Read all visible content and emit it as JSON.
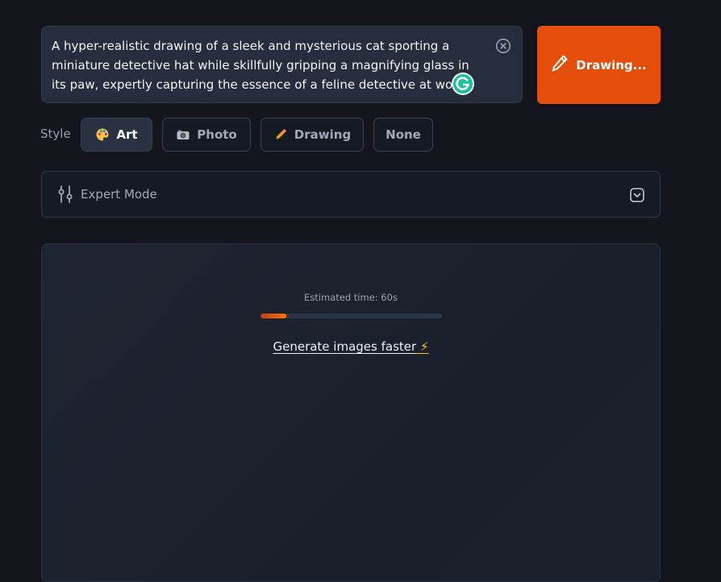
{
  "prompt": {
    "text": "A hyper-realistic drawing of a sleek and mysterious cat sporting a miniature detective hat while skillfully gripping a magnifying glass in its paw, expertly capturing the essence of a feline detective at work",
    "clear_icon": "circle-x-icon",
    "assistant_icon": "grammarly-icon"
  },
  "draw_button": {
    "label": "Drawing...",
    "icon": "pencil-icon",
    "color": "#e44d0a"
  },
  "style": {
    "label": "Style",
    "options": [
      {
        "label": "Art",
        "icon": "palette-icon",
        "selected": true
      },
      {
        "label": "Photo",
        "icon": "camera-icon",
        "selected": false
      },
      {
        "label": "Drawing",
        "icon": "pencil-icon",
        "selected": false
      },
      {
        "label": "None",
        "icon": "",
        "selected": false
      }
    ]
  },
  "expert_mode": {
    "label": "Expert Mode",
    "icon": "sliders-icon",
    "chevron": "chevron-down-icon"
  },
  "generation": {
    "estimated_time": "Estimated time: 60s",
    "progress": 0.14,
    "faster_link": "Generate images faster",
    "faster_icon": "⚡"
  }
}
